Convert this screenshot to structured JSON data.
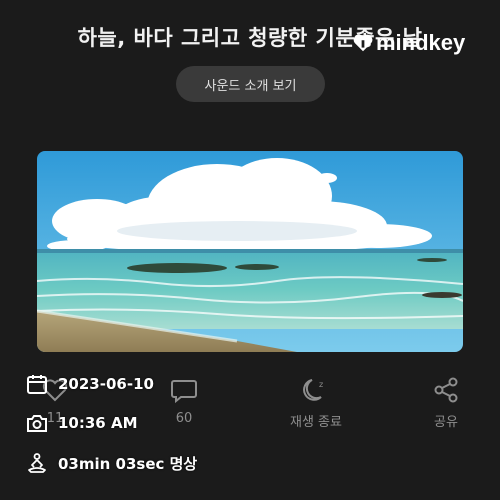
{
  "header": {
    "title": "하늘, 바다 그리고 청량한 기분좋은 날",
    "watermark": "mindkey"
  },
  "sound_intro_button": "사운드 소개 보기",
  "hero_image": {
    "scene": "beach-with-clouds",
    "sky_color": "#3aa7dd",
    "sea_color": "#5fc1bf"
  },
  "actions": [
    {
      "icon": "heart-icon",
      "label": "11"
    },
    {
      "icon": "comment-icon",
      "label": "60"
    },
    {
      "icon": "sleep-moon-icon",
      "label": "재생 종료"
    },
    {
      "icon": "share-icon",
      "label": "공유"
    }
  ],
  "overlay_info": {
    "date": "2023-06-10",
    "time": "10:36 AM",
    "meditation": "03min 03sec 명상"
  }
}
